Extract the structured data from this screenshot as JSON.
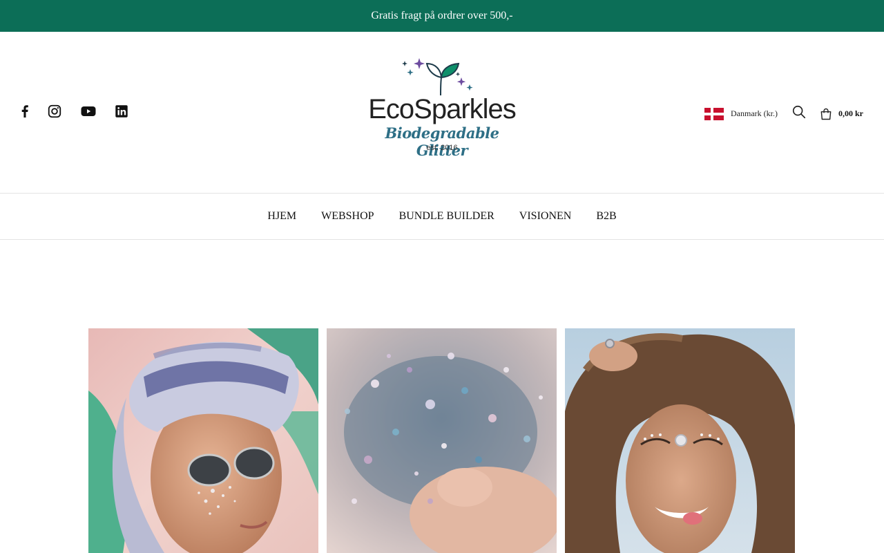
{
  "announcement": {
    "text": "Gratis fragt på ordrer over 500,-"
  },
  "social": [
    {
      "icon": "facebook-icon",
      "label": "Facebook"
    },
    {
      "icon": "instagram-icon",
      "label": "Instagram"
    },
    {
      "icon": "youtube-icon",
      "label": "YouTube"
    },
    {
      "icon": "linkedin-icon",
      "label": "LinkedIn"
    }
  ],
  "logo": {
    "name": "EcoSparkles",
    "tagline": "Biodegradable Glitter",
    "est": "est. 2016"
  },
  "header": {
    "country_label": "Danmark (kr.)",
    "cart_total": "0,00 kr"
  },
  "nav": {
    "items": [
      "HJEM",
      "WEBSHOP",
      "BUNDLE BUILDER",
      "VISIONEN",
      "B2B"
    ]
  },
  "colors": {
    "announcement_bg": "#0c6e57",
    "announcement_text": "#ffffff",
    "logo_tagline": "#2e6f86",
    "flag_red": "#c8102e"
  }
}
